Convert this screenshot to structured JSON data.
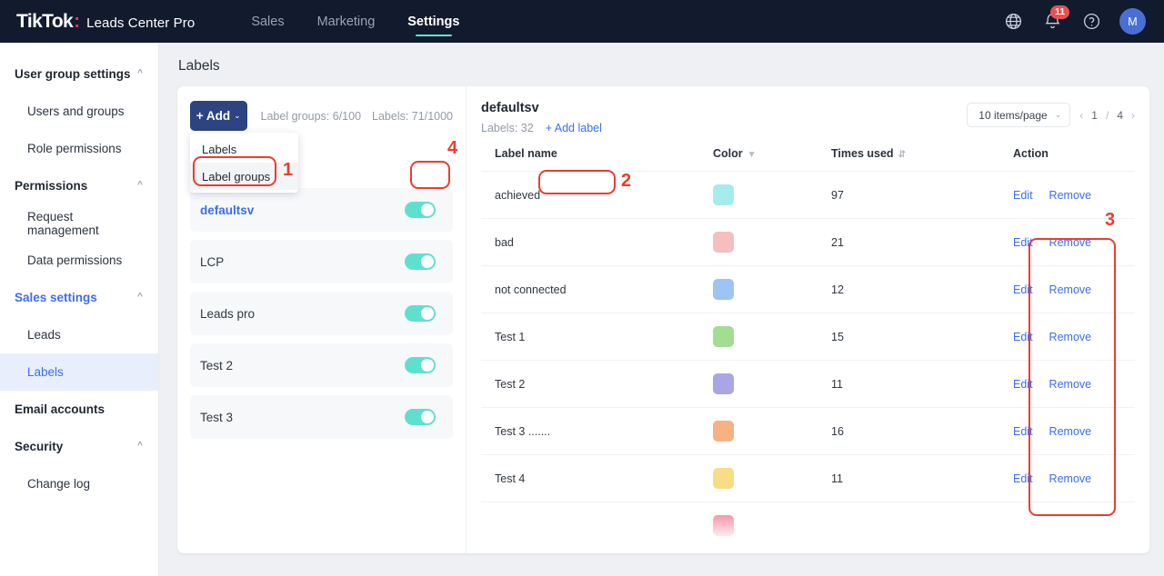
{
  "header": {
    "brand_name": "TikTok",
    "brand_colon": ":",
    "brand_sub": "Leads Center Pro",
    "tabs": [
      {
        "label": "Sales",
        "active": false
      },
      {
        "label": "Marketing",
        "active": false
      },
      {
        "label": "Settings",
        "active": true
      }
    ],
    "icons": {
      "globe": "globe-icon",
      "bell": "bell-icon",
      "help": "help-icon"
    },
    "notification_count": "11",
    "avatar_initial": "M",
    "accent_underline": "#5fe3d4",
    "background": "#121a2e"
  },
  "sidebar": {
    "items": [
      {
        "label": "User group settings",
        "type": "group",
        "expanded": true,
        "active": false
      },
      {
        "label": "Users and groups",
        "type": "item",
        "active": false
      },
      {
        "label": "Role permissions",
        "type": "item",
        "active": false
      },
      {
        "label": "Permissions",
        "type": "group",
        "expanded": true,
        "active": false
      },
      {
        "label": "Request management",
        "type": "item",
        "active": false
      },
      {
        "label": "Data permissions",
        "type": "item",
        "active": false
      },
      {
        "label": "Sales settings",
        "type": "group",
        "expanded": true,
        "active": true
      },
      {
        "label": "Leads",
        "type": "item",
        "active": false
      },
      {
        "label": "Labels",
        "type": "item",
        "active": true
      },
      {
        "label": "Email accounts",
        "type": "group",
        "expanded": false,
        "active": false
      },
      {
        "label": "Security",
        "type": "group",
        "expanded": true,
        "active": false
      },
      {
        "label": "Change log",
        "type": "item",
        "active": false
      }
    ]
  },
  "main": {
    "page_title": "Labels"
  },
  "toolbar": {
    "add_label": "+ Add",
    "add_caret": "⌄",
    "label_groups_count": "Label groups: 6/100",
    "labels_count": "Labels: 71/1000",
    "dropdown": {
      "items": [
        {
          "label": "Labels",
          "hover": false
        },
        {
          "label": "Label groups",
          "hover": true
        }
      ]
    }
  },
  "groups": {
    "rows": [
      {
        "name": "defaultsv",
        "enabled": true,
        "selected": true
      },
      {
        "name": "LCP",
        "enabled": true,
        "selected": false
      },
      {
        "name": "Leads pro",
        "enabled": true,
        "selected": false
      },
      {
        "name": "Test 2",
        "enabled": true,
        "selected": false
      },
      {
        "name": "Test 3",
        "enabled": true,
        "selected": false
      }
    ]
  },
  "detail": {
    "title": "defaultsv",
    "labels_count": "Labels: 32",
    "add_label_link": "+ Add label",
    "pagination": {
      "page_size": "10 items/page",
      "caret": "⌄",
      "prev": "‹",
      "next": "›",
      "current_page": "1",
      "separator": "/",
      "total_pages": "4"
    },
    "table": {
      "columns": [
        {
          "label": "Label name",
          "icon": ""
        },
        {
          "label": "Color",
          "icon": "filter-icon"
        },
        {
          "label": "Times used",
          "icon": "sort-icon"
        },
        {
          "label": "Action",
          "icon": ""
        }
      ],
      "rows": [
        {
          "name": "achieved",
          "color": "#a5ecea",
          "times_used": "97",
          "edit": "Edit",
          "remove": "Remove"
        },
        {
          "name": "bad",
          "color": "#f5bfbe",
          "times_used": "21",
          "edit": "Edit",
          "remove": "Remove"
        },
        {
          "name": "not connected",
          "color": "#9dc4f5",
          "times_used": "12",
          "edit": "Edit",
          "remove": "Remove"
        },
        {
          "name": "Test 1",
          "color": "#a3dd90",
          "times_used": "15",
          "edit": "Edit",
          "remove": "Remove"
        },
        {
          "name": "Test 2",
          "color": "#a9a6e4",
          "times_used": "11",
          "edit": "Edit",
          "remove": "Remove"
        },
        {
          "name": "Test 3 .......",
          "color": "#f7b183",
          "times_used": "16",
          "edit": "Edit",
          "remove": "Remove"
        },
        {
          "name": "Test 4",
          "color": "#f8dd84",
          "times_used": "11",
          "edit": "Edit",
          "remove": "Remove"
        },
        {
          "name": "",
          "color": "#f58fa4",
          "times_used": "",
          "edit": "",
          "remove": ""
        }
      ]
    }
  },
  "annotations": [
    {
      "number": "1",
      "target": "dropdown-label-groups"
    },
    {
      "number": "2",
      "target": "add-label-link"
    },
    {
      "number": "3",
      "target": "action-column"
    },
    {
      "number": "4",
      "target": "group-toggle"
    }
  ],
  "colors": {
    "accent_blue": "#3a6df0",
    "brand_dark": "#121a2e",
    "toggle_on": "#5fe0cf",
    "annotation_red": "#ec3c2d",
    "tiktok_pink": "#fe2c55"
  }
}
